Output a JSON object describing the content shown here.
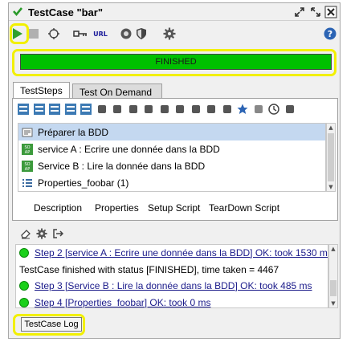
{
  "window": {
    "title": "TestCase \"bar\"",
    "url_label": "URL"
  },
  "status": {
    "text": "FINISHED",
    "progress": 1.0,
    "color": "#00c000"
  },
  "tabs": [
    {
      "label": "TestSteps",
      "active": true
    },
    {
      "label": "Test On Demand",
      "active": false
    }
  ],
  "steps": [
    {
      "label": "Préparer la BDD",
      "icon": "groovy-script-icon",
      "selected": true
    },
    {
      "label": "service A : Ecrire une donnée dans la BDD",
      "icon": "soap-request-icon",
      "selected": false
    },
    {
      "label": "Service B : Lire la donnée dans la BDD",
      "icon": "soap-request-icon",
      "selected": false
    },
    {
      "label": "Properties_foobar (1)",
      "icon": "properties-icon",
      "selected": false
    }
  ],
  "subtabs": [
    "Description",
    "Properties",
    "Setup Script",
    "TearDown Script"
  ],
  "log": [
    {
      "text": "Step 2 [service A : Ecrire une donnée dans la BDD] OK: took 1530 ms",
      "dot": true,
      "link": true
    },
    {
      "text": "TestCase finished with status [FINISHED], time taken = 4467",
      "dot": false,
      "link": false
    },
    {
      "text": "Step 3 [Service B : Lire la donnée dans la BDD] OK: took 485 ms",
      "dot": true,
      "link": true
    },
    {
      "text": "Step 4 [Properties_foobar] OK: took 0 ms",
      "dot": true,
      "link": true
    }
  ],
  "log_button": "TestCase Log",
  "highlight_color": "#f2f000"
}
